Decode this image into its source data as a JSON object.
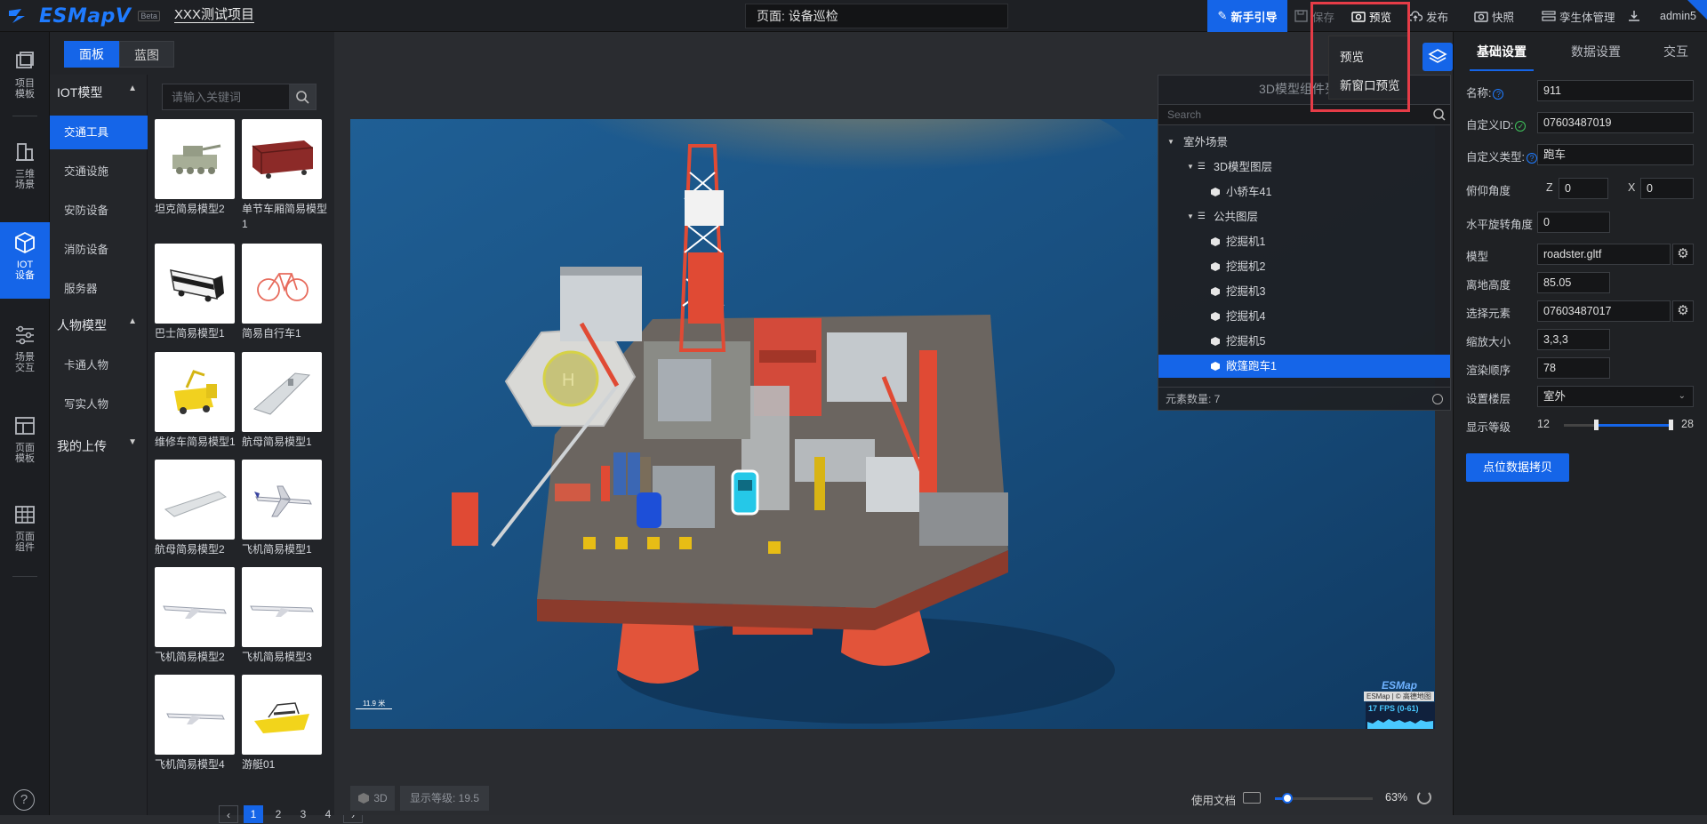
{
  "app": {
    "logo_text": "ESMapV",
    "beta": "Beta",
    "project_name": "XXX测试项目",
    "page_label": "页面: 设备巡检"
  },
  "toolbar": {
    "guide": "新手引导",
    "save": "保存",
    "preview": "预览",
    "publish": "发布",
    "snapshot": "快照",
    "twin_manage": "孪生体管理",
    "user": "admin5"
  },
  "preview_menu": {
    "items": [
      "预览",
      "新窗口预览"
    ]
  },
  "leftnav": {
    "items": [
      {
        "label": "项目模板"
      },
      {
        "label": "三维场景"
      },
      {
        "label": "IOT设备"
      },
      {
        "label": "场景交互"
      },
      {
        "label": "页面模板"
      },
      {
        "label": "页面组件"
      }
    ],
    "help": "?"
  },
  "panel": {
    "tabs": [
      "面板",
      "蓝图"
    ],
    "search_placeholder": "请输入关键词",
    "groups": [
      {
        "title": "IOT模型",
        "items": [
          "交通工具",
          "交通设施",
          "安防设备",
          "消防设备",
          "服务器"
        ]
      },
      {
        "title": "人物模型",
        "items": [
          "卡通人物",
          "写实人物"
        ]
      },
      {
        "title": "我的上传",
        "items": []
      }
    ],
    "cards": [
      {
        "label": "坦克简易模型2"
      },
      {
        "label": "单节车厢简易模型1"
      },
      {
        "label": "巴士简易模型1"
      },
      {
        "label": "简易自行车1"
      },
      {
        "label": "维修车简易模型1"
      },
      {
        "label": "航母简易模型1"
      },
      {
        "label": "航母简易模型2"
      },
      {
        "label": "飞机简易模型1"
      },
      {
        "label": "飞机简易模型2"
      },
      {
        "label": "飞机简易模型3"
      },
      {
        "label": "飞机简易模型4"
      },
      {
        "label": "游艇01"
      }
    ],
    "pager": {
      "pages": [
        "1",
        "2",
        "3",
        "4"
      ],
      "current": "1"
    }
  },
  "viewport": {
    "scale_label": "11.9 米",
    "watermark": "ESMap",
    "copyright": "ESMap | © 高德地图",
    "fps": "17 FPS (0-61)",
    "mode": "3D",
    "display_level": "显示等级: 19.5",
    "use_doc": "使用文档",
    "zoom": "63%",
    "zoom_fraction": 0.63
  },
  "tree": {
    "title": "3D模型组件列表",
    "search_placeholder": "Search",
    "nodes": [
      {
        "label": "室外场景"
      },
      {
        "label": "3D模型图层"
      },
      {
        "label": "小轿车41"
      },
      {
        "label": "公共图层"
      },
      {
        "label": "挖掘机1"
      },
      {
        "label": "挖掘机2"
      },
      {
        "label": "挖掘机3"
      },
      {
        "label": "挖掘机4"
      },
      {
        "label": "挖掘机5"
      },
      {
        "label": "敞篷跑车1"
      }
    ],
    "count": "元素数量: 7"
  },
  "props": {
    "tabs": [
      "基础设置",
      "数据设置",
      "交互"
    ],
    "name_label": "名称:",
    "name": "911",
    "custom_id_label": "自定义ID:",
    "custom_id": "07603487019",
    "custom_type_label": "自定义类型:",
    "custom_type": "跑车",
    "pitch_label": "俯仰角度",
    "z_label": "Z",
    "z_value": "0",
    "x_label": "X",
    "x_value": "0",
    "rotation_label": "水平旋转角度",
    "rotation": "0",
    "model_label": "模型",
    "model": "roadster.gltf",
    "height_label": "离地高度",
    "height": "85.05",
    "element_label": "选择元素",
    "element": "07603487017",
    "scale_label": "缩放大小",
    "scale": "3,3,3",
    "render_label": "渲染顺序",
    "render": "78",
    "floor_label": "设置楼层",
    "floor": "室外",
    "level_label": "显示等级",
    "level_min": "12",
    "level_max": "28",
    "copy_btn": "点位数据拷贝"
  },
  "colors": {
    "accent": "#1565e8",
    "highlight": "#e63c47",
    "bg": "#2b2d31"
  }
}
